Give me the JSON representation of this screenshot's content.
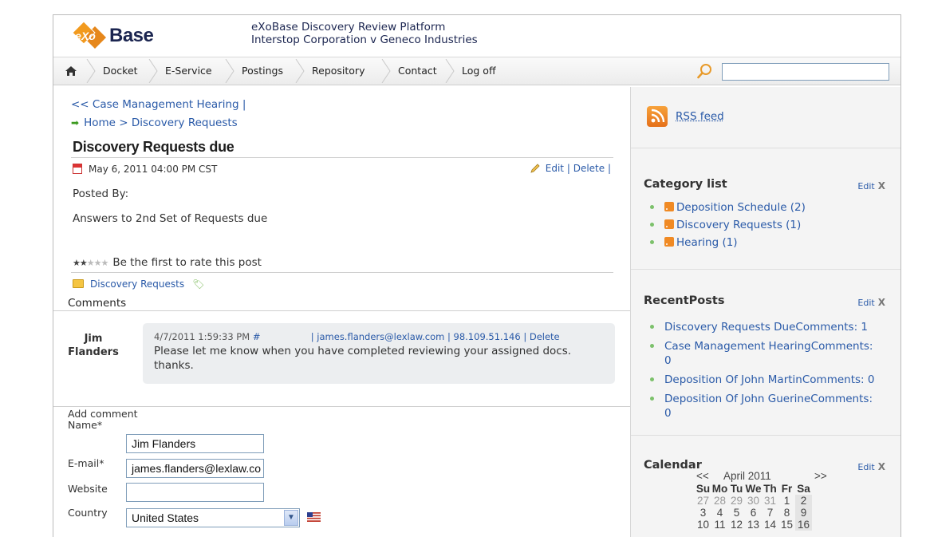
{
  "header": {
    "logo_text": "Base",
    "logo_letter": "eXo",
    "site_title": "eXoBase Discovery Review Platform",
    "site_subtitle": "Interstop Corporation v Geneco Industries"
  },
  "nav": {
    "items": [
      "Docket",
      "E-Service",
      "Postings",
      "Repository",
      "Contact",
      "Log off"
    ],
    "search_value": ""
  },
  "post": {
    "back_link": "<< Case Management Hearing |",
    "breadcrumb_home": "Home",
    "breadcrumb_sep": ">",
    "breadcrumb_current": "Discovery Requests",
    "title": "Discovery Requests due",
    "date": "May 6, 2011 04:00 PM CST",
    "edit_label": "Edit",
    "delete_label": "Delete",
    "posted_by": "Posted By:",
    "body": "Answers to 2nd Set of Requests due",
    "rating_value": 2,
    "rating_max": 5,
    "rating_text": "Be the first to rate this post",
    "category": "Discovery Requests"
  },
  "comments": {
    "label": "Comments",
    "items": [
      {
        "author_first": "Jim",
        "author_last": "Flanders",
        "timestamp": "4/7/2011 1:59:33 PM",
        "permalink": "#",
        "email": "james.flanders@lexlaw.com",
        "ip": "98.109.51.146",
        "delete_label": "Delete",
        "text": "Please let me know when you have completed reviewing your assigned docs.  thanks."
      }
    ]
  },
  "form": {
    "heading": "Add comment",
    "name_label": "Name*",
    "name_value": "Jim Flanders",
    "email_label": "E-mail*",
    "email_value": "james.flanders@lexlaw.co",
    "website_label": "Website",
    "website_value": "",
    "country_label": "Country",
    "country_value": "United States"
  },
  "sidebar": {
    "rss_label": "RSS feed",
    "edit_label": "Edit",
    "close_label": "X",
    "category_title": "Category list",
    "categories": [
      "Deposition Schedule (2)",
      "Discovery Requests (1)",
      "Hearing (1)"
    ],
    "recent_title": "RecentPosts",
    "recent": [
      {
        "title": "Discovery Requests Due",
        "comments": "Comments: 1"
      },
      {
        "title": "Case Management Hearing",
        "comments": "Comments: 0"
      },
      {
        "title": "Deposition Of John Martin",
        "comments": "Comments: 0"
      },
      {
        "title": "Deposition Of John Guerine",
        "comments": "Comments: 0"
      }
    ],
    "calendar_title": "Calendar",
    "calendar": {
      "prev": "<<",
      "month": "April 2011",
      "next": ">>",
      "weekdays": [
        "Su",
        "Mo",
        "Tu",
        "We",
        "Th",
        "Fr",
        "Sa"
      ],
      "rows": [
        [
          "27",
          "28",
          "29",
          "30",
          "31",
          "1",
          "2"
        ],
        [
          "3",
          "4",
          "5",
          "6",
          "7",
          "8",
          "9"
        ],
        [
          "10",
          "11",
          "12",
          "13",
          "14",
          "15",
          "16"
        ]
      ]
    }
  },
  "colors": {
    "link": "#2a5aa8",
    "logo_orange": "#f29a1e",
    "logo_navy": "#1b2550",
    "bullet_green": "#7cc16b",
    "rss_orange": "#f08a24"
  }
}
